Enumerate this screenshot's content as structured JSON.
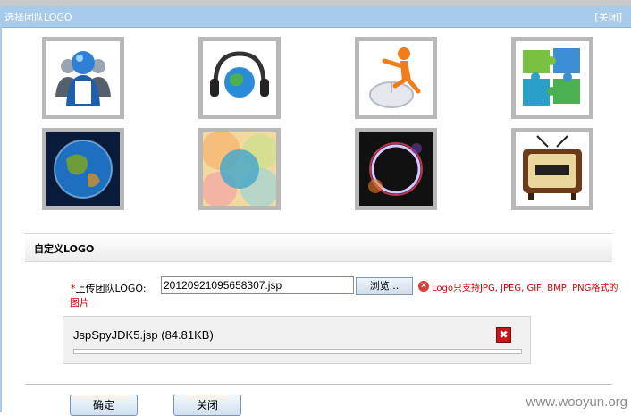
{
  "dialog": {
    "title": "选择团队LOGO",
    "close_link": "[关闭]"
  },
  "logos": [
    {
      "icon": "team-users-icon",
      "selected": false
    },
    {
      "icon": "headphones-globe-icon",
      "selected": false
    },
    {
      "icon": "person-mouse-icon",
      "selected": false
    },
    {
      "icon": "puzzle-icon",
      "selected": false
    },
    {
      "icon": "earth-icon",
      "selected": false
    },
    {
      "icon": "bokeh-circles-icon",
      "selected": false
    },
    {
      "icon": "light-ring-icon",
      "selected": false
    },
    {
      "icon": "television-icon",
      "selected": false
    }
  ],
  "custom": {
    "section_title": "自定义LOGO",
    "required_mark": "*",
    "upload_label": "上传团队LOGO:",
    "file_value": "20120921095658307.jsp",
    "browse_label": "浏览...",
    "error_text_line1": "Logo只支持JPG, JPEG, GIF, BMP, PNG格式的",
    "error_text_line2": "图片"
  },
  "upload_item": {
    "file_label": "JspSpyJDK5.jsp (84.81KB)",
    "delete_symbol": "✖",
    "progress": 0.0
  },
  "buttons": {
    "confirm": "确定",
    "close": "关闭"
  },
  "watermark": "www.wooyun.org",
  "colors": {
    "title_bar": "#a9cbeb",
    "error": "#cc0000",
    "logo_border": "#b8b8b8"
  }
}
